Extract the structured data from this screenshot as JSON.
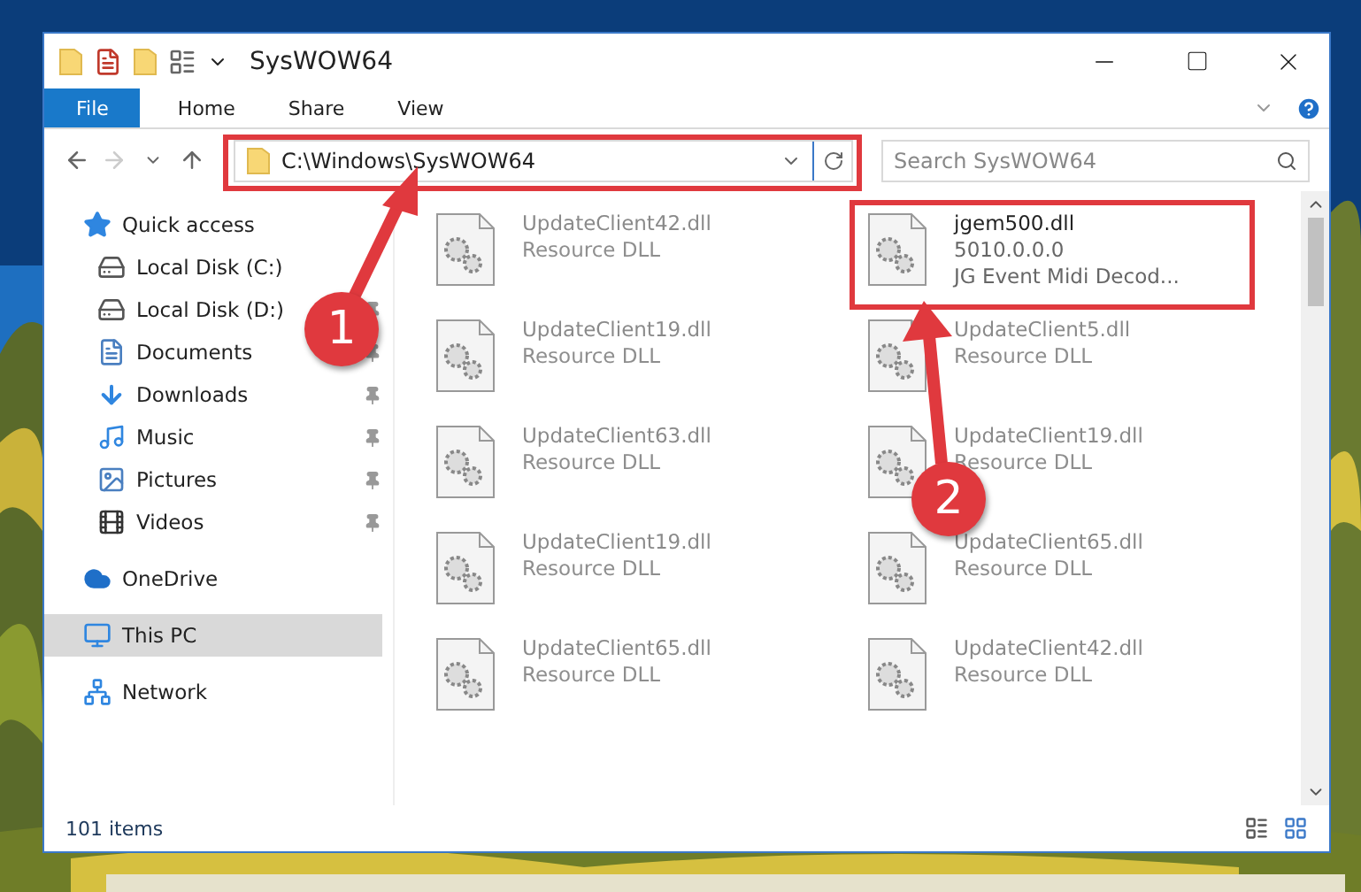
{
  "window": {
    "title": "SysWOW64"
  },
  "ribbon_tabs": [
    {
      "label": "File",
      "kind": "file"
    },
    {
      "label": "Home",
      "kind": "tab"
    },
    {
      "label": "Share",
      "kind": "tab"
    },
    {
      "label": "View",
      "kind": "tab"
    }
  ],
  "address": {
    "path": "C:\\Windows\\SysWOW64"
  },
  "search": {
    "placeholder": "Search SysWOW64"
  },
  "nav": [
    {
      "label": "Quick access",
      "selected": false,
      "children": [
        {
          "label": "Local Disk (C:)",
          "pinned": false,
          "selected": false
        },
        {
          "label": "Local Disk (D:)",
          "pinned": true,
          "selected": false
        },
        {
          "label": "Documents",
          "pinned": true,
          "selected": false
        },
        {
          "label": "Downloads",
          "pinned": true,
          "selected": false
        },
        {
          "label": "Music",
          "pinned": true,
          "selected": false
        },
        {
          "label": "Pictures",
          "pinned": true,
          "selected": false
        },
        {
          "label": "Videos",
          "pinned": true,
          "selected": false
        }
      ]
    },
    {
      "label": "OneDrive",
      "selected": false
    },
    {
      "label": "This PC",
      "selected": true
    },
    {
      "label": "Network",
      "selected": false
    }
  ],
  "files": [
    {
      "name": "UpdateClient42.dll",
      "description": "Resource DLL",
      "blurred": true
    },
    {
      "name": "jgem500.dll",
      "version": "5010.0.0.0",
      "description": "JG Event Midi Decod...",
      "blurred": false
    },
    {
      "name": "UpdateClient19.dll",
      "description": "Resource DLL",
      "blurred": true
    },
    {
      "name": "UpdateClient5.dll",
      "description": "Resource DLL",
      "blurred": true
    },
    {
      "name": "UpdateClient63.dll",
      "description": "Resource DLL",
      "blurred": true
    },
    {
      "name": "UpdateClient19.dll",
      "description": "Resource DLL",
      "blurred": true
    },
    {
      "name": "UpdateClient19.dll",
      "description": "Resource DLL",
      "blurred": true
    },
    {
      "name": "UpdateClient65.dll",
      "description": "Resource DLL",
      "blurred": true
    },
    {
      "name": "UpdateClient65.dll",
      "description": "Resource DLL",
      "blurred": true
    },
    {
      "name": "UpdateClient42.dll",
      "description": "Resource DLL",
      "blurred": true
    }
  ],
  "status_bar": {
    "item_count": "101 items"
  },
  "annotations": [
    {
      "number": "1"
    },
    {
      "number": "2"
    }
  ]
}
